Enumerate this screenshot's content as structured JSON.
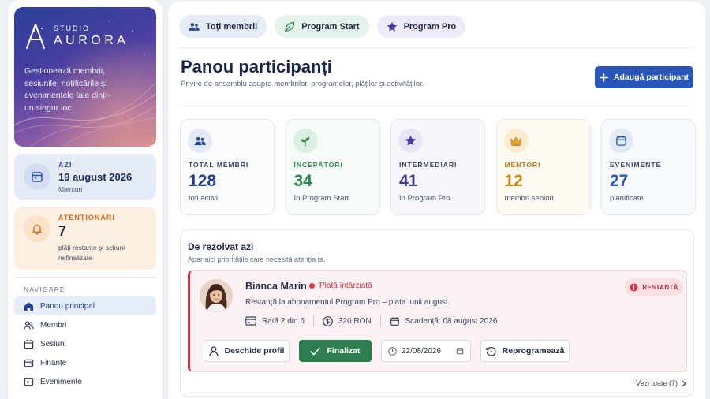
{
  "brand": {
    "studio": "STUDIO",
    "name": "AURORA",
    "description": "Gestionează membrii, sesiunile, notificările și evenimentele tale dintr-un singur loc."
  },
  "today": {
    "label": "AZI",
    "date": "19 august 2026",
    "weekday": "Miercuri"
  },
  "alerts": {
    "label": "ATENȚIONĂRI",
    "count": "7",
    "note": "plăți restante și acțiuni nefinalizate"
  },
  "nav": {
    "title": "NAVIGARE",
    "items": [
      {
        "label": "Panou principal",
        "icon": "home-icon",
        "active": true
      },
      {
        "label": "Membri",
        "icon": "users-icon"
      },
      {
        "label": "Sesiuni",
        "icon": "calendar-icon"
      },
      {
        "label": "Finanțe",
        "icon": "wallet-icon"
      },
      {
        "label": "Evenimente",
        "icon": "ticket-icon"
      }
    ]
  },
  "tabs": [
    {
      "label": "Toți membrii",
      "icon": "users-icon"
    },
    {
      "label": "Program Start",
      "icon": "leaf-icon"
    },
    {
      "label": "Program Pro",
      "icon": "star-icon"
    }
  ],
  "header": {
    "title": "Panou participanți",
    "subtitle": "Privire de ansamblu asupra membrilor, programelor, plăților și activităților.",
    "add_button": "Adaugă participant"
  },
  "stats": [
    {
      "label": "TOTAL MEMBRI",
      "value": "128",
      "note": "toți activi",
      "icon": "users-icon",
      "color": "#243f8a"
    },
    {
      "label": "ÎNCEPĂTORI",
      "value": "34",
      "note": "în Program Start",
      "icon": "sprout-icon",
      "color": "#2d8553"
    },
    {
      "label": "INTERMEDIARI",
      "value": "41",
      "note": "în Program Pro",
      "icon": "star-icon",
      "color": "#3b3f87"
    },
    {
      "label": "MENTORI",
      "value": "12",
      "note": "membri seniori",
      "icon": "crown-icon",
      "color": "#c98a18"
    },
    {
      "label": "EVENIMENTE",
      "value": "27",
      "note": "planificate",
      "icon": "calendar-icon",
      "color": "#2d5aa6"
    }
  ],
  "todo": {
    "title": "De rezolvat azi",
    "subtitle": "Apar aici prioritățile care necesită atenția ta.",
    "task": {
      "name": "Bianca Marin",
      "status": "Plată întârziată",
      "badge": "RESTANTĂ",
      "description": "Restanță la abonamentul Program Pro – plata lunii august.",
      "installment": "Rată 2 din 6",
      "amount": "320 RON",
      "due": "Scadență: 08 august 2026",
      "actions": {
        "profile": "Deschide profil",
        "done": "Finalizat",
        "date_value": "22/08/2026",
        "reschedule": "Reprogramează"
      }
    },
    "see_all": "Vezi toate (7)"
  },
  "colors": {
    "accent": "#2a56b8",
    "danger": "#c8364a",
    "success": "#2e7d4f",
    "warning": "#d86a1d"
  }
}
